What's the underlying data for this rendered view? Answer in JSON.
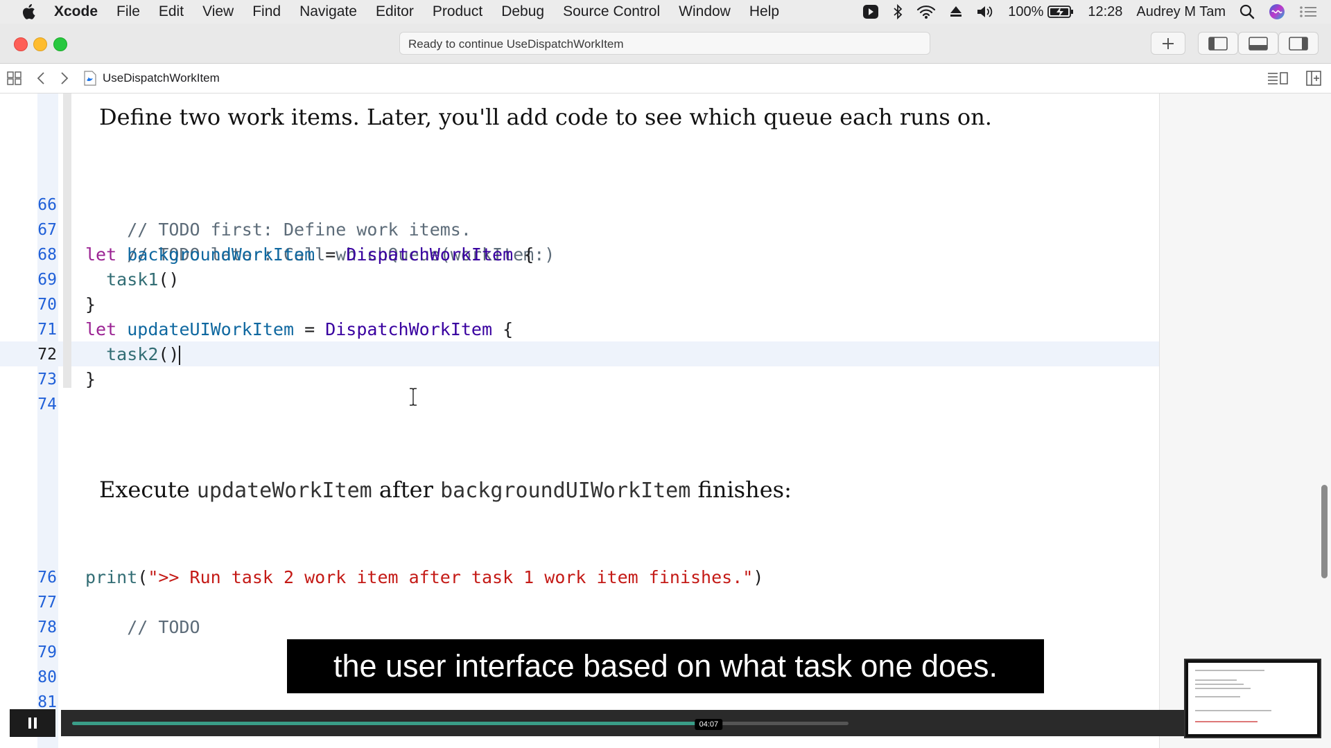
{
  "menubar": {
    "app_name": "Xcode",
    "items": [
      "File",
      "Edit",
      "View",
      "Find",
      "Navigate",
      "Editor",
      "Product",
      "Debug",
      "Source Control",
      "Window",
      "Help"
    ],
    "battery": "100%",
    "time": "12:28",
    "user": "Audrey M Tam"
  },
  "toolbar": {
    "activity_status": "Ready to continue UseDispatchWorkItem"
  },
  "jumpbar": {
    "file_name": "UseDispatchWorkItem"
  },
  "editor": {
    "prose_1": "Define two work items. Later, you'll add code to see which queue each runs on.",
    "prose_2": {
      "before": "Execute ",
      "code_a": "updateWorkItem",
      "middle": " after ",
      "code_b": "backgroundUIWorkItem",
      "after": " finishes:"
    },
    "line_numbers_top": [
      "66",
      "67",
      "68",
      "69",
      "70",
      "71",
      "72",
      "73",
      "74"
    ],
    "line_numbers_bottom": [
      "76",
      "77",
      "78",
      "79",
      "80",
      "81"
    ],
    "current_line": "72",
    "lines": {
      "l66": "// TODO first: Define work items.",
      "l67": "// TODO later: Call whichQueue(workItem:)",
      "l68_kw": "let",
      "l68_var": "backgroundWorkItem",
      "l68_eq": " = ",
      "l68_type": "DispatchWorkItem",
      "l68_brace": " {",
      "l69_func": "task1",
      "l69_paren": "()",
      "l70": "}",
      "l71_kw": "let",
      "l71_var": "updateUIWorkItem",
      "l71_eq": " = ",
      "l71_type": "DispatchWorkItem",
      "l71_brace": " {",
      "l72_func": "task2",
      "l72_paren": "()",
      "l73": "}",
      "l76_func": "print",
      "l76_open": "(",
      "l76_str": "\">> Run task 2 work item after task 1 work item finishes.\"",
      "l76_close": ")",
      "l77": "// TODO"
    }
  },
  "video": {
    "caption": "the user interface based on what task one does.",
    "timestamp": "04:07",
    "progress": 0.82
  },
  "colors": {
    "accent_progress": "#3a9e88",
    "line_number": "#2060d8",
    "keyword": "#9b2393",
    "string": "#c41a16"
  }
}
